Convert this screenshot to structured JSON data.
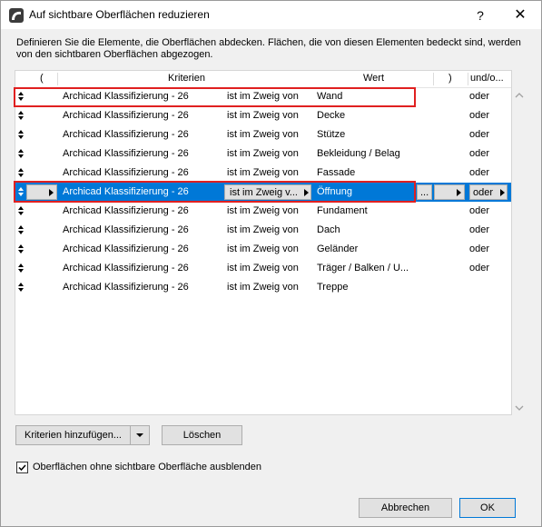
{
  "window": {
    "title": "Auf sichtbare Oberflächen reduzieren",
    "help": "?",
    "close": "✕"
  },
  "description": "Definieren Sie die Elemente, die Oberflächen abdecken. Flächen, die von diesen Elementen bedeckt sind, werden von den sichtbaren Oberflächen abgezogen.",
  "table": {
    "headers": {
      "open_paren": "(",
      "criteria": "Kriterien",
      "value": "Wert",
      "close_paren": ")",
      "andor": "und/o..."
    },
    "rows": [
      {
        "criterion": "Archicad Klassifizierung - 26",
        "operator": "ist im Zweig von",
        "value": "Wand",
        "andor": "oder"
      },
      {
        "criterion": "Archicad Klassifizierung - 26",
        "operator": "ist im Zweig von",
        "value": "Decke",
        "andor": "oder"
      },
      {
        "criterion": "Archicad Klassifizierung - 26",
        "operator": "ist im Zweig von",
        "value": "Stütze",
        "andor": "oder"
      },
      {
        "criterion": "Archicad Klassifizierung - 26",
        "operator": "ist im Zweig von",
        "value": "Bekleidung / Belag",
        "andor": "oder"
      },
      {
        "criterion": "Archicad Klassifizierung - 26",
        "operator": "ist im Zweig von",
        "value": "Fassade",
        "andor": "oder"
      },
      {
        "criterion": "Archicad Klassifizierung - 26",
        "operator": "ist im Zweig v...",
        "value": "Öffnung",
        "andor": "oder",
        "selected": true,
        "value_button": "..."
      },
      {
        "criterion": "Archicad Klassifizierung - 26",
        "operator": "ist im Zweig von",
        "value": "Fundament",
        "andor": "oder"
      },
      {
        "criterion": "Archicad Klassifizierung - 26",
        "operator": "ist im Zweig von",
        "value": "Dach",
        "andor": "oder"
      },
      {
        "criterion": "Archicad Klassifizierung - 26",
        "operator": "ist im Zweig von",
        "value": "Geländer",
        "andor": "oder"
      },
      {
        "criterion": "Archicad Klassifizierung - 26",
        "operator": "ist im Zweig von",
        "value": "Träger / Balken / U...",
        "andor": "oder"
      },
      {
        "criterion": "Archicad Klassifizierung - 26",
        "operator": "ist im Zweig von",
        "value": "Treppe",
        "andor": ""
      }
    ]
  },
  "buttons": {
    "add_criteria": "Kriterien hinzufügen...",
    "delete": "Löschen",
    "cancel": "Abbrechen",
    "ok": "OK"
  },
  "checkbox": {
    "label": "Oberflächen ohne sichtbare Oberfläche ausblenden",
    "checked": true
  },
  "colors": {
    "selection": "#0078d7",
    "highlight": "#e02020"
  }
}
